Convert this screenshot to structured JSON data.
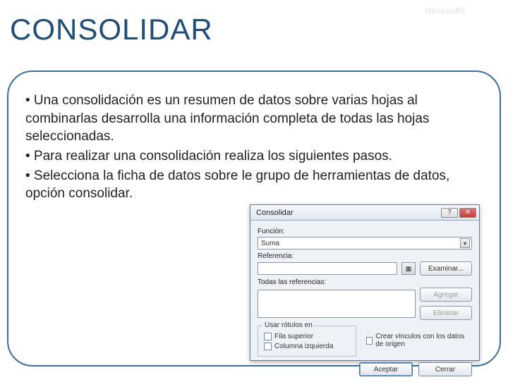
{
  "watermark": "Microsoft®",
  "title": "CONSOLIDAR",
  "bullets": [
    "• Una  consolidación es un resumen de datos sobre varias hojas  al combinarlas  desarrolla una información completa de todas las hojas seleccionadas.",
    "• Para realizar una  consolidación realiza los siguientes pasos.",
    "• Selecciona la ficha de datos  sobre le grupo de herramientas de datos, opción consolidar."
  ],
  "dialog": {
    "title": "Consolidar",
    "labels": {
      "funcion": "Función:",
      "referencia": "Referencia:",
      "todas": "Todas las referencias:",
      "grupo": "Usar rótulos en"
    },
    "funcion_value": "Suma",
    "buttons": {
      "examinar": "Examinar...",
      "agregar": "Agregar",
      "eliminar": "Eliminar",
      "aceptar": "Aceptar",
      "cerrar": "Cerrar"
    },
    "checks": {
      "fila": "Fila superior",
      "col": "Columna izquierda",
      "vinculos": "Crear vínculos con los datos de origen"
    }
  }
}
